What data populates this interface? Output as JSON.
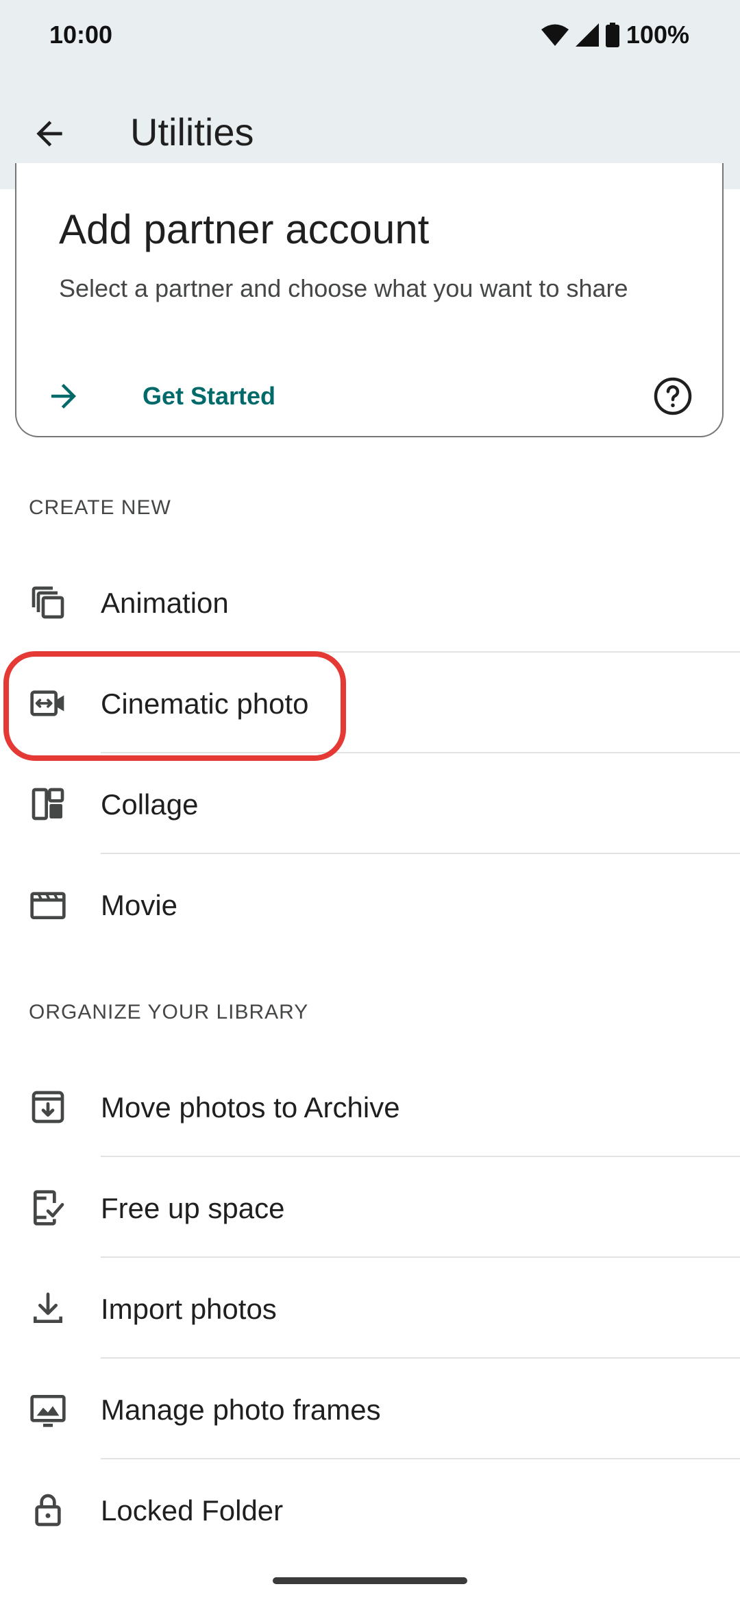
{
  "status_bar": {
    "time": "10:00",
    "battery": "100%",
    "icons": [
      "wifi-icon",
      "cellular-signal-icon",
      "battery-icon"
    ]
  },
  "app_bar": {
    "back_icon": "arrow-back-icon",
    "title": "Utilities"
  },
  "partner_card": {
    "title": "Add partner account",
    "subtitle": "Select a partner and choose what you want to share",
    "action_label": "Get Started",
    "action_icon": "arrow-forward-icon",
    "help_icon": "help-circle-icon"
  },
  "create_new": {
    "header": "CREATE NEW",
    "items": [
      {
        "label": "Animation",
        "icon": "animation-icon"
      },
      {
        "label": "Cinematic photo",
        "icon": "cinematic-photo-icon",
        "highlighted": true
      },
      {
        "label": "Collage",
        "icon": "collage-icon"
      },
      {
        "label": "Movie",
        "icon": "movie-icon"
      }
    ]
  },
  "organize": {
    "header": "ORGANIZE YOUR LIBRARY",
    "items": [
      {
        "label": "Move photos to Archive",
        "icon": "archive-icon"
      },
      {
        "label": "Free up space",
        "icon": "phone-check-icon"
      },
      {
        "label": "Import photos",
        "icon": "download-icon"
      },
      {
        "label": "Manage photo frames",
        "icon": "photo-frame-icon"
      },
      {
        "label": "Locked Folder",
        "icon": "lock-icon"
      }
    ]
  },
  "colors": {
    "app_bar_bg": "#e9eef1",
    "accent": "#006a6a",
    "highlight": "#e53935"
  }
}
